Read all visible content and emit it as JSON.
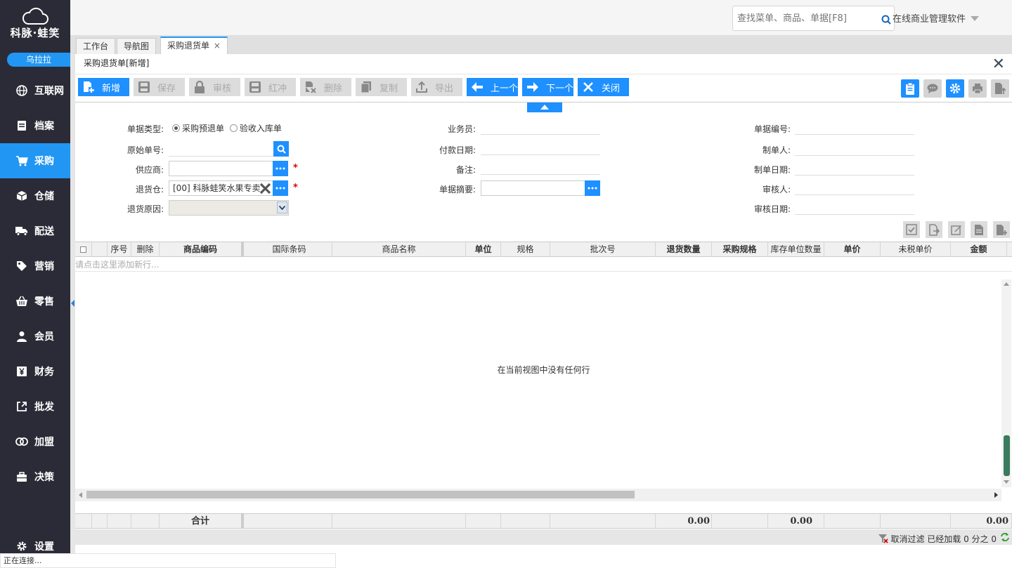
{
  "sidebar": {
    "logo_text": "科脉·蛙笑",
    "user": "乌拉拉",
    "items": [
      {
        "label": "互联网",
        "icon": "globe-icon"
      },
      {
        "label": "档案",
        "icon": "file-icon"
      },
      {
        "label": "采购",
        "icon": "cart-icon",
        "active": true
      },
      {
        "label": "仓储",
        "icon": "box-icon"
      },
      {
        "label": "配送",
        "icon": "truck-icon"
      },
      {
        "label": "营销",
        "icon": "tag-icon"
      },
      {
        "label": "零售",
        "icon": "basket-icon"
      },
      {
        "label": "会员",
        "icon": "user-icon"
      },
      {
        "label": "财务",
        "icon": "yen-icon"
      },
      {
        "label": "批发",
        "icon": "external-icon"
      },
      {
        "label": "加盟",
        "icon": "rings-icon"
      },
      {
        "label": "决策",
        "icon": "briefcase-icon"
      }
    ],
    "settings_label": "设置"
  },
  "header": {
    "search_placeholder": "查找菜单、商品、单据[F8]",
    "brand": "在线商业管理软件"
  },
  "tabs": [
    {
      "label": "工作台"
    },
    {
      "label": "导航图"
    },
    {
      "label": "采购退货单",
      "close": "×",
      "active": true
    }
  ],
  "panel": {
    "title": "采购退货单[新增]",
    "toolbar": {
      "new": "新增",
      "save": "保存",
      "audit": "审核",
      "redflush": "红冲",
      "delete": "删除",
      "copy": "复制",
      "export": "导出",
      "prev": "上一个",
      "next": "下一个",
      "close": "关闭"
    }
  },
  "form": {
    "doc_type_label": "单据类型:",
    "doc_type_options": [
      "采购预退单",
      "验收入库单"
    ],
    "orig_no_label": "原始单号:",
    "supplier_label": "供应商:",
    "warehouse_label": "退货仓:",
    "warehouse_value": "[00] 科脉蛙笑水果专卖",
    "reason_label": "退货原因:",
    "salesman_label": "业务员:",
    "pay_date_label": "付款日期:",
    "remark_label": "备注:",
    "summary_label": "单据摘要:",
    "doc_no_label": "单据编号:",
    "maker_label": "制单人:",
    "make_date_label": "制单日期:",
    "auditor_label": "审核人:",
    "audit_date_label": "审核日期:",
    "required_mark": "*"
  },
  "grid": {
    "columns": [
      "序号",
      "删除",
      "商品编码",
      "国际条码",
      "商品名称",
      "单位",
      "规格",
      "批次号",
      "退货数量",
      "采购规格",
      "库存单位数量",
      "单价",
      "未税单价",
      "金额"
    ],
    "add_row_hint": "请点击这里添加新行...",
    "empty_message": "在当前视图中没有任何行",
    "footer": {
      "label": "合计",
      "qty_total": "0.00",
      "stock_total": "0.00",
      "amount_total": "0.00"
    },
    "status": {
      "cancel_filter": "取消过滤",
      "loaded": "已经加载 0 分之 0"
    }
  },
  "statusbar": {
    "text": "正在连接..."
  }
}
